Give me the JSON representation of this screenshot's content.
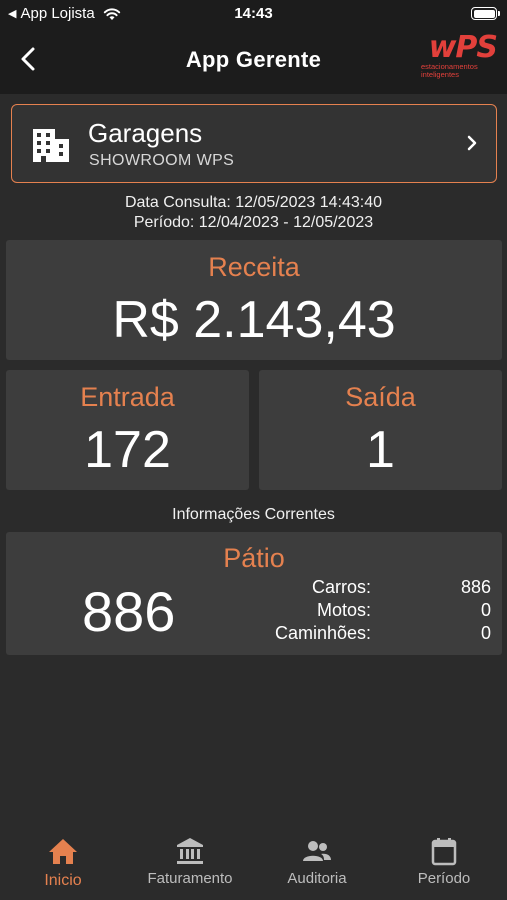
{
  "status": {
    "back_app": "App Lojista",
    "time": "14:43"
  },
  "nav": {
    "title": "App Gerente"
  },
  "logo": {
    "mark": "wPS",
    "sub1": "estacionamentos",
    "sub2": "inteligentes"
  },
  "garage": {
    "title": "Garagens",
    "subtitle": "SHOWROOM WPS"
  },
  "consulta": {
    "data": "Data Consulta: 12/05/2023 14:43:40",
    "periodo": "Período: 12/04/2023 - 12/05/2023"
  },
  "receita": {
    "label": "Receita",
    "value": "R$ 2.143,43"
  },
  "entrada": {
    "label": "Entrada",
    "value": "172"
  },
  "saida": {
    "label": "Saída",
    "value": "1"
  },
  "info_correntes": "Informações Correntes",
  "patio": {
    "label": "Pátio",
    "total": "886",
    "rows": [
      {
        "label": "Carros:",
        "value": "886"
      },
      {
        "label": "Motos:",
        "value": "0"
      },
      {
        "label": "Caminhões:",
        "value": "0"
      }
    ]
  },
  "tabs": [
    {
      "label": "Inicio",
      "icon": "home-icon",
      "active": true
    },
    {
      "label": "Faturamento",
      "icon": "bank-icon",
      "active": false
    },
    {
      "label": "Auditoria",
      "icon": "people-icon",
      "active": false
    },
    {
      "label": "Período",
      "icon": "calendar-icon",
      "active": false
    }
  ],
  "colors": {
    "accent": "#e5814f",
    "background": "#2b2b2b",
    "panel": "#3d3d3d",
    "bar": "#1c1c1c",
    "logo": "#e2403b"
  }
}
